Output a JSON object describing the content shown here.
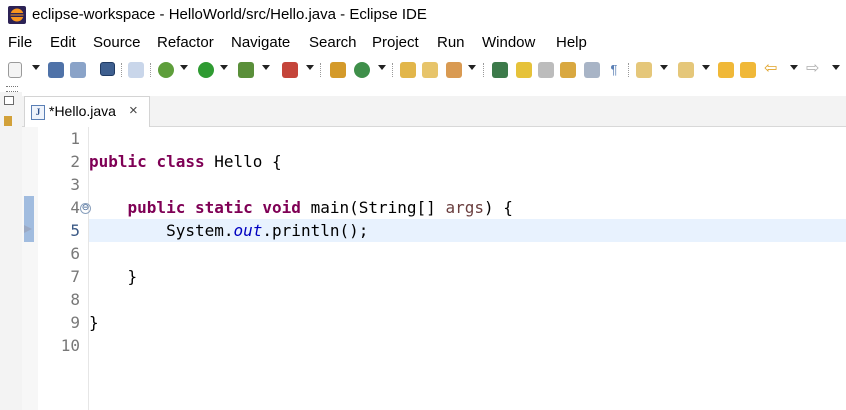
{
  "window": {
    "title": "eclipse-workspace - HelloWorld/src/Hello.java - Eclipse IDE"
  },
  "menu": [
    "File",
    "Edit",
    "Source",
    "Refactor",
    "Navigate",
    "Search",
    "Project",
    "Run",
    "Window",
    "Help"
  ],
  "editor": {
    "tab": {
      "label": "*Hello.java",
      "close": "×",
      "icon_letter": "J"
    },
    "lines": [
      {
        "n": "1",
        "code": ""
      },
      {
        "n": "2",
        "code": "public class Hello {"
      },
      {
        "n": "3",
        "code": ""
      },
      {
        "n": "4",
        "code": "    public static void main(String[] args) {"
      },
      {
        "n": "5",
        "code": "        System.out.println();"
      },
      {
        "n": "6",
        "code": ""
      },
      {
        "n": "7",
        "code": "    }"
      },
      {
        "n": "8",
        "code": ""
      },
      {
        "n": "9",
        "code": "}"
      },
      {
        "n": "10",
        "code": ""
      }
    ],
    "current_line": "5",
    "fold_glyph": "⊖"
  },
  "colors": {
    "keyword": "#7f0055",
    "parameter": "#6a3e3e",
    "static_field": "#0000c0",
    "current_line_bg": "#e8f2fe"
  },
  "icons": {
    "app": "eclipse-icon",
    "toolbar": [
      "new-icon",
      "save-icon",
      "save-all-icon",
      "terminal-icon",
      "skip-breakpoints-icon",
      "debug-icon",
      "run-icon",
      "coverage-icon",
      "external-tools-icon",
      "new-java-project-icon",
      "new-package-icon",
      "new-class-icon",
      "open-type-icon",
      "open-task-icon",
      "search-icon",
      "toggle-mark-occurrences-icon",
      "block-selection-icon",
      "show-whitespace-icon",
      "next-annotation-icon",
      "previous-annotation-icon",
      "last-edit-location-icon",
      "back-icon",
      "forward-icon"
    ]
  }
}
